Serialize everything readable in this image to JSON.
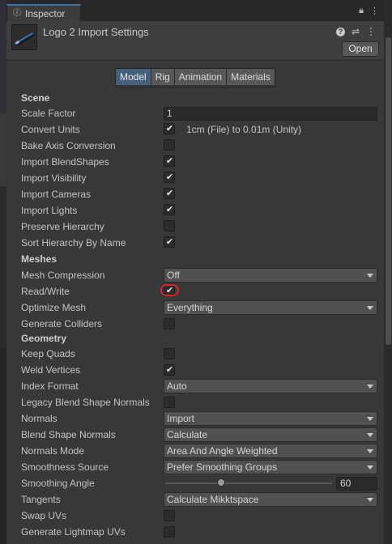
{
  "window": {
    "tab_title": "Inspector"
  },
  "header": {
    "title": "Logo 2 Import Settings",
    "open_label": "Open"
  },
  "tabs": [
    {
      "label": "Model",
      "active": true
    },
    {
      "label": "Rig",
      "active": false
    },
    {
      "label": "Animation",
      "active": false
    },
    {
      "label": "Materials",
      "active": false
    }
  ],
  "sections": {
    "scene": "Scene",
    "meshes": "Meshes",
    "geometry": "Geometry"
  },
  "fields": {
    "scale_factor": {
      "label": "Scale Factor",
      "value": "1"
    },
    "convert_units": {
      "label": "Convert Units",
      "checked": true,
      "hint": "1cm (File) to 0.01m (Unity)"
    },
    "bake_axis": {
      "label": "Bake Axis Conversion",
      "checked": false
    },
    "import_blendshapes": {
      "label": "Import BlendShapes",
      "checked": true
    },
    "import_visibility": {
      "label": "Import Visibility",
      "checked": true
    },
    "import_cameras": {
      "label": "Import Cameras",
      "checked": true
    },
    "import_lights": {
      "label": "Import Lights",
      "checked": true
    },
    "preserve_hierarchy": {
      "label": "Preserve Hierarchy",
      "checked": false
    },
    "sort_hierarchy": {
      "label": "Sort Hierarchy By Name",
      "checked": true
    },
    "mesh_compression": {
      "label": "Mesh Compression",
      "value": "Off"
    },
    "read_write": {
      "label": "Read/Write",
      "checked": true
    },
    "optimize_mesh": {
      "label": "Optimize Mesh",
      "value": "Everything"
    },
    "generate_colliders": {
      "label": "Generate Colliders",
      "checked": false
    },
    "keep_quads": {
      "label": "Keep Quads",
      "checked": false
    },
    "weld_vertices": {
      "label": "Weld Vertices",
      "checked": true
    },
    "index_format": {
      "label": "Index Format",
      "value": "Auto"
    },
    "legacy_blend": {
      "label": "Legacy Blend Shape Normals",
      "checked": false
    },
    "normals": {
      "label": "Normals",
      "value": "Import"
    },
    "blend_shape_normals": {
      "label": "Blend Shape Normals",
      "value": "Calculate"
    },
    "normals_mode": {
      "label": "Normals Mode",
      "value": "Area And Angle Weighted"
    },
    "smoothness_source": {
      "label": "Smoothness Source",
      "value": "Prefer Smoothing Groups"
    },
    "smoothing_angle": {
      "label": "Smoothing Angle",
      "value": "60",
      "max": 180
    },
    "tangents": {
      "label": "Tangents",
      "value": "Calculate Mikktspace"
    },
    "swap_uvs": {
      "label": "Swap UVs",
      "checked": false
    },
    "lightmap_uvs": {
      "label": "Generate Lightmap UVs",
      "checked": false
    }
  },
  "colors": {
    "accent": "#3a72b0",
    "active_tab": "#46607c",
    "highlight": "#e0202b"
  }
}
